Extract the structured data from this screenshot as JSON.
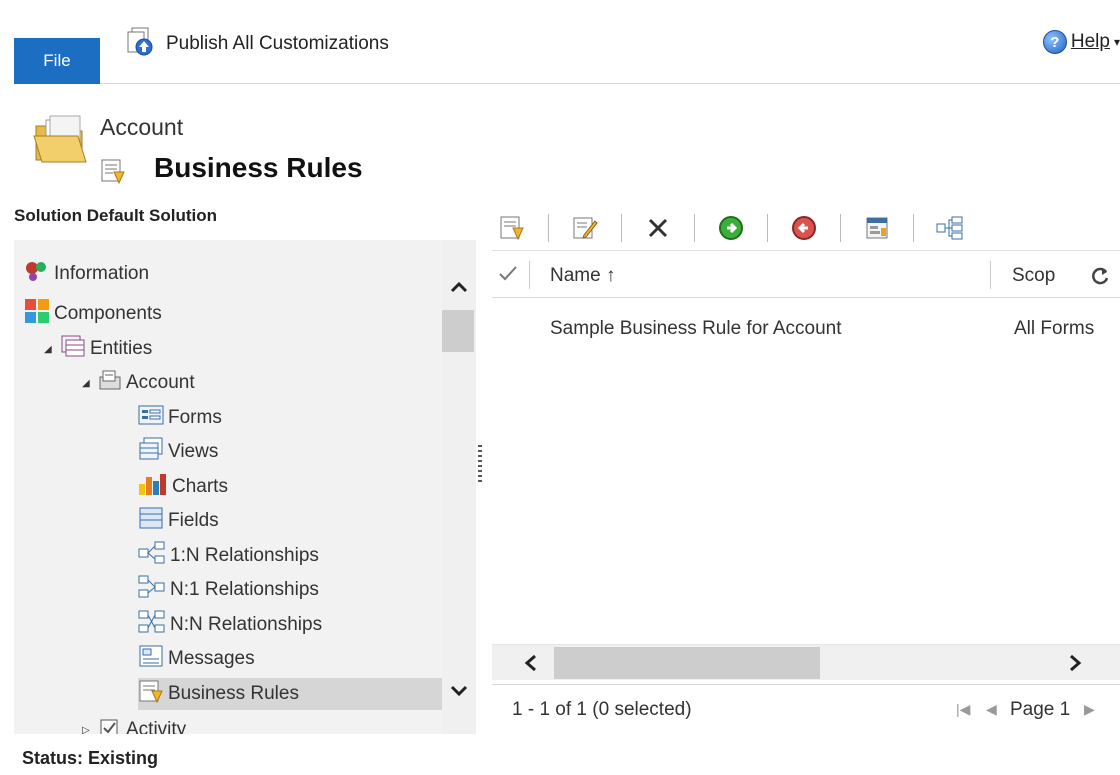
{
  "ribbon": {
    "file_label": "File",
    "publish_label": "Publish All Customizations",
    "help_label": "Help"
  },
  "header": {
    "entity": "Account",
    "title": "Business Rules"
  },
  "solution": {
    "title": "Solution Default Solution"
  },
  "nav": {
    "items": [
      {
        "label": "Information",
        "icon": "information-icon"
      },
      {
        "label": "Components",
        "icon": "components-icon"
      },
      {
        "label": "Entities",
        "icon": "entities-icon"
      },
      {
        "label": "Account",
        "icon": "entity-icon"
      },
      {
        "label": "Forms",
        "icon": "forms-icon"
      },
      {
        "label": "Views",
        "icon": "views-icon"
      },
      {
        "label": "Charts",
        "icon": "charts-icon"
      },
      {
        "label": "Fields",
        "icon": "fields-icon"
      },
      {
        "label": "1:N Relationships",
        "icon": "one-to-many-icon"
      },
      {
        "label": "N:1 Relationships",
        "icon": "many-to-one-icon"
      },
      {
        "label": "N:N Relationships",
        "icon": "many-to-many-icon"
      },
      {
        "label": "Messages",
        "icon": "messages-icon"
      },
      {
        "label": "Business Rules",
        "icon": "business-rules-icon",
        "selected": true
      },
      {
        "label": "Activity",
        "icon": "activity-icon"
      }
    ]
  },
  "grid": {
    "columns": {
      "name": "Name ↑",
      "scope": "Scop"
    },
    "rows": [
      {
        "name": "Sample Business Rule for Account",
        "scope": "All Forms"
      }
    ],
    "record_count": "1 - 1 of 1 (0 selected)",
    "page_label": "Page 1"
  },
  "status": {
    "text": "Status: Existing"
  },
  "colors": {
    "file_tab": "#1b6ec2",
    "nav_bg": "#f2f2f2",
    "selected_bg": "#d6d6d6"
  }
}
